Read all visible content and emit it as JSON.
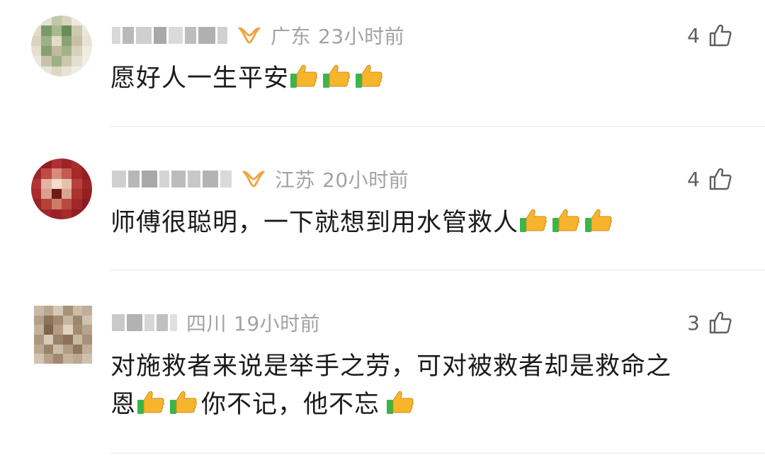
{
  "comments": [
    {
      "location": "广东",
      "time": "23小时前",
      "likes": "4",
      "text_before": "愿好人一生平安",
      "text_after": "",
      "emoji_before": 3,
      "has_vip": true,
      "avatar_style": "round-blurred"
    },
    {
      "location": "江苏",
      "time": "20小时前",
      "likes": "4",
      "text_before": "师傅很聪明，一下就想到用水管救人",
      "text_after": "",
      "emoji_before": 3,
      "has_vip": true,
      "avatar_style": "round-blurred"
    },
    {
      "location": "四川",
      "time": "19小时前",
      "likes": "3",
      "text_line1": "对施救者来说是举手之劳，可对被救者却是救命之",
      "text_line2_a": "恩",
      "text_line2_b": "你不记，他不忘",
      "has_vip": false,
      "avatar_style": "square-blurred"
    }
  ],
  "icons": {
    "like": "thumbs-up-outline-icon",
    "vip": "vip-loop-icon",
    "emoji": "thumbs-up-emoji"
  },
  "colors": {
    "meta_text": "#a3a3a3",
    "body_text": "#1b1b1b",
    "vip_orange": "#f0a542",
    "emoji_yellow": "#f7b52c",
    "emoji_green": "#3bb54a",
    "divider": "#e6e6e6"
  }
}
